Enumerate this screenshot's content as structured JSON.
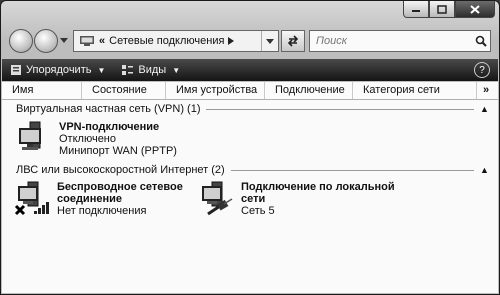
{
  "address": {
    "path": "Сетевые подключения"
  },
  "search": {
    "placeholder": "Поиск"
  },
  "toolbar": {
    "organize": "Упорядочить",
    "views": "Виды",
    "help": "?"
  },
  "columns": [
    "Имя",
    "Состояние",
    "Имя устройства",
    "Подключение",
    "Категория сети"
  ],
  "more_columns": "»",
  "groups": [
    {
      "title": "Виртуальная частная сеть (VPN) (1)",
      "items": [
        {
          "name": "VPN-подключение",
          "status": "Отключено",
          "device": "Минипорт WAN (PPTP)"
        }
      ]
    },
    {
      "title": "ЛВС или высокоскоростной Интернет (2)",
      "items": [
        {
          "name_line1": "Беспроводное сетевое",
          "name_line2": "соединение",
          "status": "Нет подключения",
          "icon": "wireless-network-disconnected-icon"
        },
        {
          "name_line1": "Подключение по локальной",
          "name_line2": "сети",
          "status": "Сеть  5",
          "icon": "lan-connection-icon"
        }
      ]
    }
  ]
}
